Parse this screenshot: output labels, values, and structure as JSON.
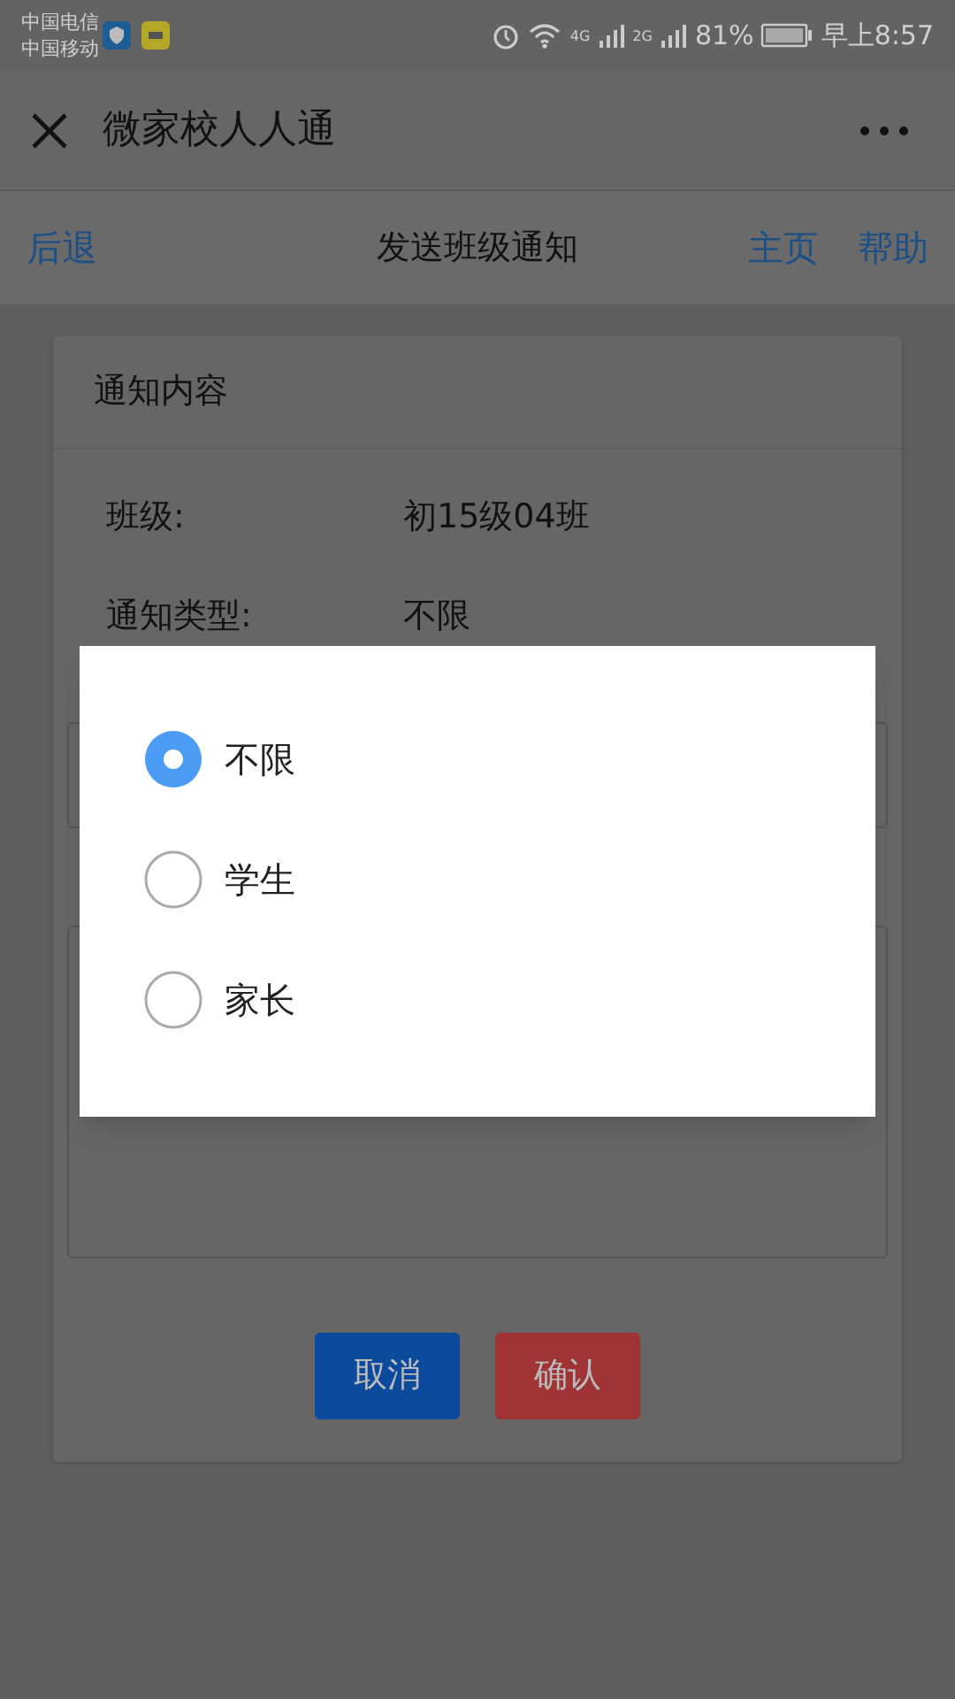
{
  "status_bar": {
    "carriers": [
      "中国电信",
      "中国移动"
    ],
    "network_1": "4G",
    "network_2": "2G",
    "battery": "81%",
    "time": "早上8:57"
  },
  "app_bar": {
    "title": "微家校人人通"
  },
  "nav": {
    "back": "后退",
    "title": "发送班级通知",
    "home": "主页",
    "help": "帮助"
  },
  "card": {
    "title": "通知内容",
    "rows": [
      {
        "label": "班级:",
        "value": "初15级04班"
      },
      {
        "label": "通知类型:",
        "value": "不限"
      }
    ]
  },
  "buttons": [
    {
      "label": "取消",
      "kind": "cancel"
    },
    {
      "label": "确认",
      "kind": "confirm"
    }
  ],
  "dialog": {
    "options": [
      {
        "label": "不限",
        "selected": true
      },
      {
        "label": "学生",
        "selected": false
      },
      {
        "label": "家长",
        "selected": false
      }
    ]
  }
}
